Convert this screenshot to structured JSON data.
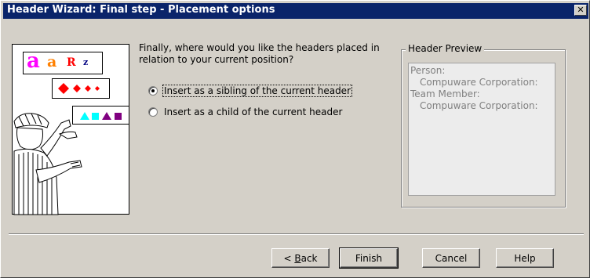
{
  "window": {
    "title": "Header Wizard: Final step - Placement options",
    "close_glyph": "✕"
  },
  "content": {
    "question_line1": "Finally, where would you like the headers placed in",
    "question_line2": "relation to your current position?",
    "options": [
      {
        "label": "Insert as a sibling of the current header",
        "checked": true
      },
      {
        "label": "Insert as a child of the current header",
        "checked": false
      }
    ]
  },
  "preview": {
    "title": "Header Preview",
    "lines": [
      {
        "text": "Person:",
        "indent": false
      },
      {
        "text": "Compuware Corporation:",
        "indent": true
      },
      {
        "text": "Team Member:",
        "indent": false
      },
      {
        "text": "Compuware Corporation:",
        "indent": true
      }
    ]
  },
  "illustration": {
    "letters": [
      "a",
      "a",
      "R",
      "z"
    ],
    "colors": {
      "pink": "#ff00ff",
      "orange": "#ff8000",
      "red": "#ff0000",
      "navy": "#000080",
      "cyan": "#00ffff",
      "purple": "#800080"
    }
  },
  "buttons": {
    "back_prefix": "< ",
    "back_mnemonic": "B",
    "back_rest": "ack",
    "finish": "Finish",
    "cancel": "Cancel",
    "help": "Help"
  }
}
